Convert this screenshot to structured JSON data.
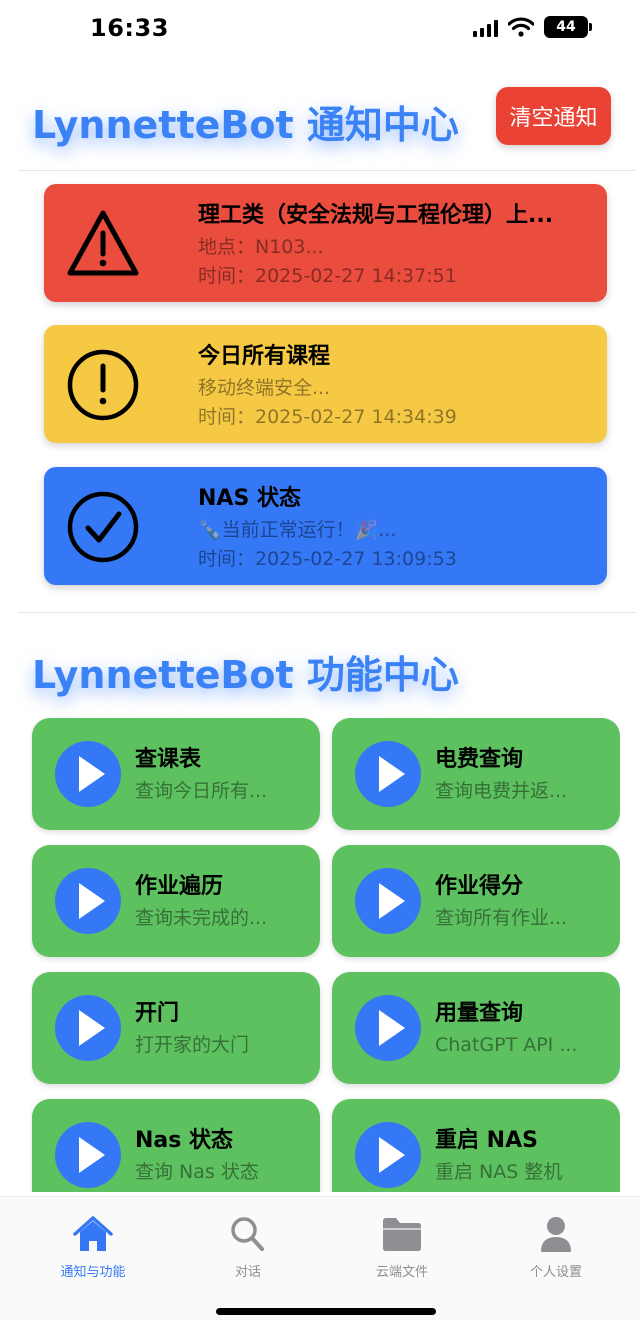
{
  "status_bar": {
    "time": "16:33",
    "battery": "44"
  },
  "notifications": {
    "title": "LynnetteBot 通知中心",
    "clear_button": "清空通知",
    "items": [
      {
        "icon": "warning-icon",
        "color": "#ea4c3d",
        "title": "理工类（安全法规与工程伦理）上...",
        "subtitle": "地点：N103...",
        "time": "时间：2025-02-27 14:37:51"
      },
      {
        "icon": "exclamation-circle-icon",
        "color": "#f6c944",
        "title": "今日所有课程",
        "subtitle": "移动终端安全...",
        "time": "时间：2025-02-27 14:34:39"
      },
      {
        "icon": "check-circle-icon",
        "color": "#3478f6",
        "title": "NAS 状态",
        "subtitle": "🍾当前正常运行！🎉...",
        "time": "时间：2025-02-27 13:09:53"
      }
    ]
  },
  "functions": {
    "title": "LynnetteBot 功能中心",
    "items": [
      {
        "name": "查课表",
        "desc": "查询今日所有..."
      },
      {
        "name": "电费查询",
        "desc": "查询电费并返..."
      },
      {
        "name": "作业遍历",
        "desc": "查询未完成的..."
      },
      {
        "name": "作业得分",
        "desc": "查询所有作业..."
      },
      {
        "name": "开门",
        "desc": "打开家的大门"
      },
      {
        "name": "用量查询",
        "desc": "ChatGPT API ..."
      },
      {
        "name": "Nas 状态",
        "desc": "查询 Nas 状态"
      },
      {
        "name": "重启 NAS",
        "desc": "重启 NAS 整机"
      }
    ],
    "card_color": "#5dc160",
    "play_color": "#3478f6"
  },
  "tab_bar": {
    "tabs": [
      {
        "label": "通知与功能",
        "icon": "house-icon",
        "active": true
      },
      {
        "label": "对话",
        "icon": "magnifying-glass-icon",
        "active": false
      },
      {
        "label": "云端文件",
        "icon": "folder-icon",
        "active": false
      },
      {
        "label": "个人设置",
        "icon": "person-icon",
        "active": false
      }
    ]
  }
}
